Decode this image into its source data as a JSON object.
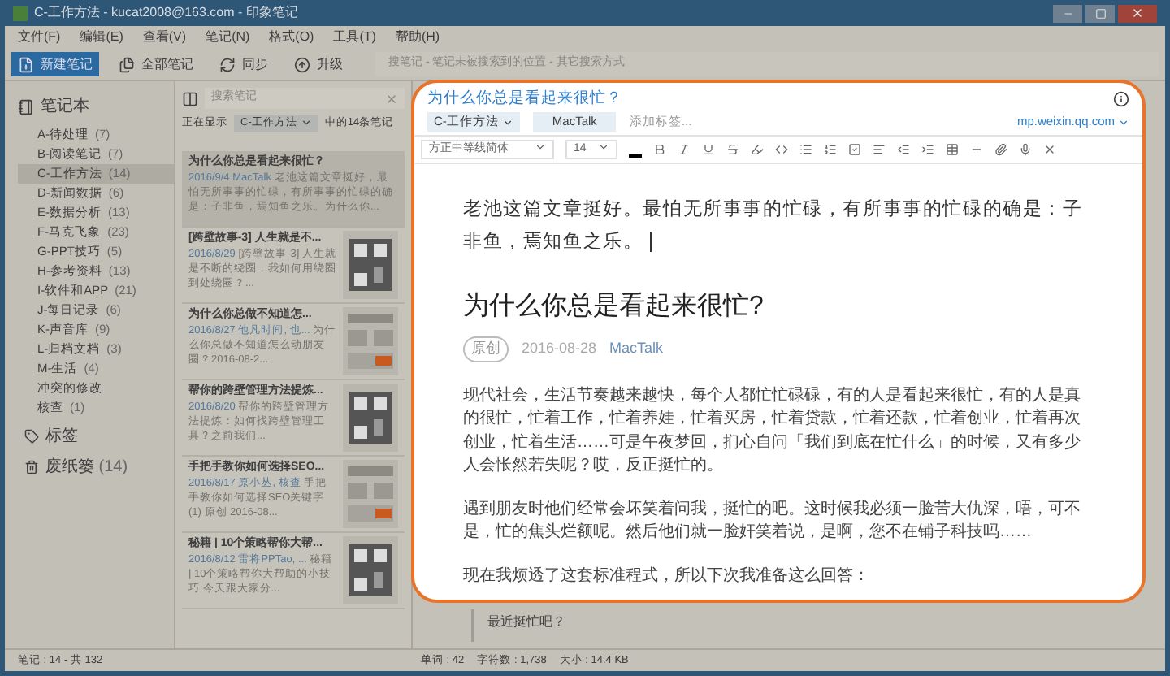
{
  "window": {
    "title": "C-工作方法 - kucat2008@163.com - 印象笔记"
  },
  "menu": [
    "文件(F)",
    "编辑(E)",
    "查看(V)",
    "笔记(N)",
    "格式(O)",
    "工具(T)",
    "帮助(H)"
  ],
  "toolbar": {
    "buttons": [
      {
        "label": "新建笔记",
        "kind": "new"
      },
      {
        "label": "全部笔记",
        "kind": "notes"
      },
      {
        "label": "同步",
        "kind": "sync"
      },
      {
        "label": "升级",
        "kind": "upgrade"
      }
    ],
    "search_hint": "搜笔记 - 笔记未被搜索到的位置 - 其它搜索方式"
  },
  "sidebar": {
    "header": "笔记本",
    "items": [
      {
        "name": "A-待处理",
        "count": "(7)",
        "selected": false
      },
      {
        "name": "B-阅读笔记",
        "count": "(7)",
        "selected": false
      },
      {
        "name": "C-工作方法",
        "count": "(14)",
        "selected": true
      },
      {
        "name": "D-新闻数据",
        "count": "(6)",
        "selected": false
      },
      {
        "name": "E-数据分析",
        "count": "(13)",
        "selected": false
      },
      {
        "name": "F-马克飞象",
        "count": "(23)",
        "selected": false
      },
      {
        "name": "G-PPT技巧",
        "count": "(5)",
        "selected": false
      },
      {
        "name": "H-参考资料",
        "count": "(13)",
        "selected": false
      },
      {
        "name": "I-软件和APP",
        "count": "(21)",
        "selected": false
      },
      {
        "name": "J-每日记录",
        "count": "(6)",
        "selected": false
      },
      {
        "name": "K-声音库",
        "count": "(9)",
        "selected": false
      },
      {
        "name": "L-归档文档",
        "count": "(3)",
        "selected": false
      },
      {
        "name": "M-生活",
        "count": "(4)",
        "selected": false
      },
      {
        "name": "冲突的修改",
        "selected": false
      },
      {
        "name": "核查",
        "count": "(1)",
        "selected": false
      }
    ],
    "tags": "标签",
    "trash": {
      "name": "废纸篓",
      "count": "(14)"
    }
  },
  "note_list": {
    "search_placeholder": "搜索笔记",
    "showing_prefix": "正在显示",
    "showing_notebook": "C-工作方法",
    "showing_suffix": "中的14条笔记",
    "notes": [
      {
        "title": "为什么你总是看起来很忙？",
        "meta": "2016/9/4 MacTalk",
        "snippet": "老池这篇文章挺好，最怕无所事事的忙碌，有所事事的忙碌的确是：子非鱼，焉知鱼之乐。为什么你...",
        "selected": true
      },
      {
        "title": "[跨壁故事-3] 人生就是不...",
        "meta": "2016/8/29",
        "snippet": "[跨壁故事-3] 人生就是不断的绕圈，我如何用绕圈到处绕圈？...",
        "selected": false,
        "has_thumbnail": true
      },
      {
        "title": "为什么你总做不知道怎...",
        "meta": "2016/8/27 他凡时间, 也...",
        "snippet": "为什么你总做不知道怎么动朋友圈？2016-08-2...",
        "selected": false,
        "has_thumbnail": true
      },
      {
        "title": "帮你的跨壁管理方法提炼...",
        "meta": "2016/8/20",
        "snippet": "帮你的跨壁管理方法提炼：如何找跨壁管理工具？之前我们...",
        "selected": false,
        "has_thumbnail": true
      },
      {
        "title": "手把手教你如何选择SEO...",
        "meta": "2016/8/17 原小丛, 核查",
        "snippet": "手把手教你如何选择SEO关键字 (1) 原创 2016-08...",
        "selected": false,
        "has_thumbnail": true
      },
      {
        "title": "秘籍 | 10个策略帮你大帮...",
        "meta": "2016/8/12 雷将PPTao, ...",
        "snippet": "秘籍 | 10个策略帮你大帮助的小技巧 今天跟大家分...",
        "selected": false,
        "has_thumbnail": true
      }
    ]
  },
  "editor": {
    "title": "为什么你总是看起来很忙？",
    "notebook": "C-工作方法",
    "tags": [
      "MacTalk"
    ],
    "tag_placeholder": "添加标签...",
    "source": "mp.weixin.qq.com",
    "font": "方正中等线简体",
    "size": "14",
    "intro": "老池这篇文章挺好。最怕无所事事的忙碌，有所事事的忙碌的确是：子非鱼，焉知鱼之乐。",
    "heading": "为什么你总是看起来很忙?",
    "badge": "原创",
    "date": "2016-08-28",
    "author": "MacTalk",
    "paragraphs": [
      "现代社会，生活节奏越来越快，每个人都忙忙碌碌，有的人是看起来很忙，有的人是真的很忙，忙着工作，忙着养娃，忙着买房，忙着贷款，忙着还款，忙着创业，忙着再次创业，忙着生活……可是午夜梦回，扪心自问「我们到底在忙什么」的时候，又有多少人会怅然若失呢？哎，反正挺忙的。",
      "遇到朋友时他们经常会坏笑着问我，挺忙的吧。这时候我必须一脸苦大仇深，唔，可不是，忙的焦头烂额呢。然后他们就一脸奸笑着说，是啊，您不在铺子科技吗……",
      "现在我烦透了这套标准程式，所以下次我准备这么回答："
    ],
    "quote": "最近挺忙吧？"
  },
  "status_bar": {
    "left": "笔记 : 14 - 共 132",
    "words": "单词 : 42",
    "chars": "字符数 : 1,738",
    "size": "大小 : 14.4 KB"
  }
}
